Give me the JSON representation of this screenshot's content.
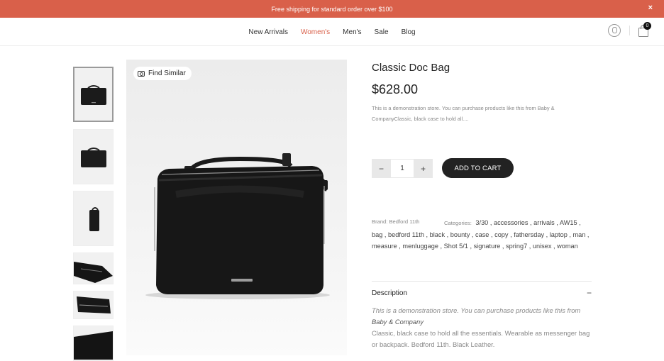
{
  "announcement": {
    "text": "Free shipping for standard order over $100",
    "close_icon": "×"
  },
  "nav": {
    "items": [
      "New Arrivals",
      "Women's",
      "Men's",
      "Sale",
      "Blog"
    ],
    "active": "Women's"
  },
  "header": {
    "cart_count": "0"
  },
  "find_similar": {
    "label": "Find Similar"
  },
  "product": {
    "title": "Classic Doc Bag",
    "price": "$628.00",
    "short_description": "This is a demonstration store. You can purchase products like this from Baby & CompanyClassic, black case to hold all....",
    "quantity": "1",
    "add_to_cart_label": "ADD TO CART",
    "qty_minus": "−",
    "qty_plus": "+",
    "brand": "Brand: Bedford 11th",
    "categories_label": "Categories:",
    "categories": [
      "3/30",
      "accessories",
      "arrivals",
      "AW15",
      "bag",
      "bedford 11th",
      "black",
      "bounty",
      "case",
      "copy",
      "fathersday",
      "laptop",
      "man",
      "measure",
      "menluggage",
      "Shot 5/1",
      "signature",
      "spring7",
      "unisex",
      "woman"
    ]
  },
  "description": {
    "heading": "Description",
    "toggle": "−",
    "intro": "This is a demonstration store. You can purchase products like this from ",
    "intro_link": "Baby & Company",
    "body": "Classic, black case to hold all the essentials. Wearable as messenger bag or backpack. Bedford 11th. Black Leather."
  },
  "colors": {
    "accent": "#d9604a",
    "button": "#222222"
  }
}
